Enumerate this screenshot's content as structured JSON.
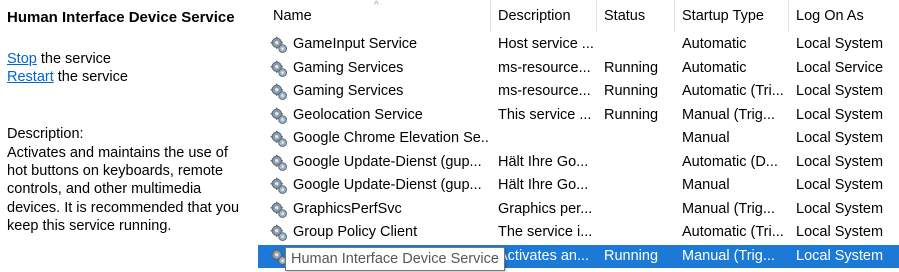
{
  "side": {
    "title": "Human Interface Device Service",
    "stop_link": "Stop",
    "stop_rest": " the service",
    "restart_link": "Restart",
    "restart_rest": " the service",
    "description_heading": "Description:",
    "description": "Activates and maintains the use of hot buttons on keyboards, remote controls, and other multimedia devices. It is recommended that you keep this service running."
  },
  "columns": {
    "name": "Name",
    "description": "Description",
    "status": "Status",
    "startup": "Startup Type",
    "logon": "Log On As"
  },
  "services": [
    {
      "name": "GameInput Service",
      "description": "Host service ...",
      "status": "",
      "startup": "Automatic",
      "logon": "Local System"
    },
    {
      "name": "Gaming Services",
      "description": "ms-resource...",
      "status": "Running",
      "startup": "Automatic",
      "logon": "Local Service"
    },
    {
      "name": "Gaming Services",
      "description": "ms-resource...",
      "status": "Running",
      "startup": "Automatic (Tri...",
      "logon": "Local System"
    },
    {
      "name": "Geolocation Service",
      "description": "This service ...",
      "status": "Running",
      "startup": "Manual (Trig...",
      "logon": "Local System"
    },
    {
      "name": "Google Chrome Elevation Se...",
      "description": "",
      "status": "",
      "startup": "Manual",
      "logon": "Local System"
    },
    {
      "name": "Google Update-Dienst (gup...",
      "description": "Hält Ihre Go...",
      "status": "",
      "startup": "Automatic (D...",
      "logon": "Local System"
    },
    {
      "name": "Google Update-Dienst (gup...",
      "description": "Hält Ihre Go...",
      "status": "",
      "startup": "Manual",
      "logon": "Local System"
    },
    {
      "name": "GraphicsPerfSvc",
      "description": "Graphics per...",
      "status": "",
      "startup": "Manual (Trig...",
      "logon": "Local System"
    },
    {
      "name": "Group Policy Client",
      "description": "The service i...",
      "status": "",
      "startup": "Automatic (Tri...",
      "logon": "Local System"
    },
    {
      "name": "Human Interface Device Service",
      "description": "Activates an...",
      "status": "Running",
      "startup": "Manual (Trig...",
      "logon": "Local System",
      "selected": true
    }
  ],
  "tooltip": "Human Interface Device Service",
  "colors": {
    "selection": "#1c7ad6",
    "link": "#0066cc"
  }
}
